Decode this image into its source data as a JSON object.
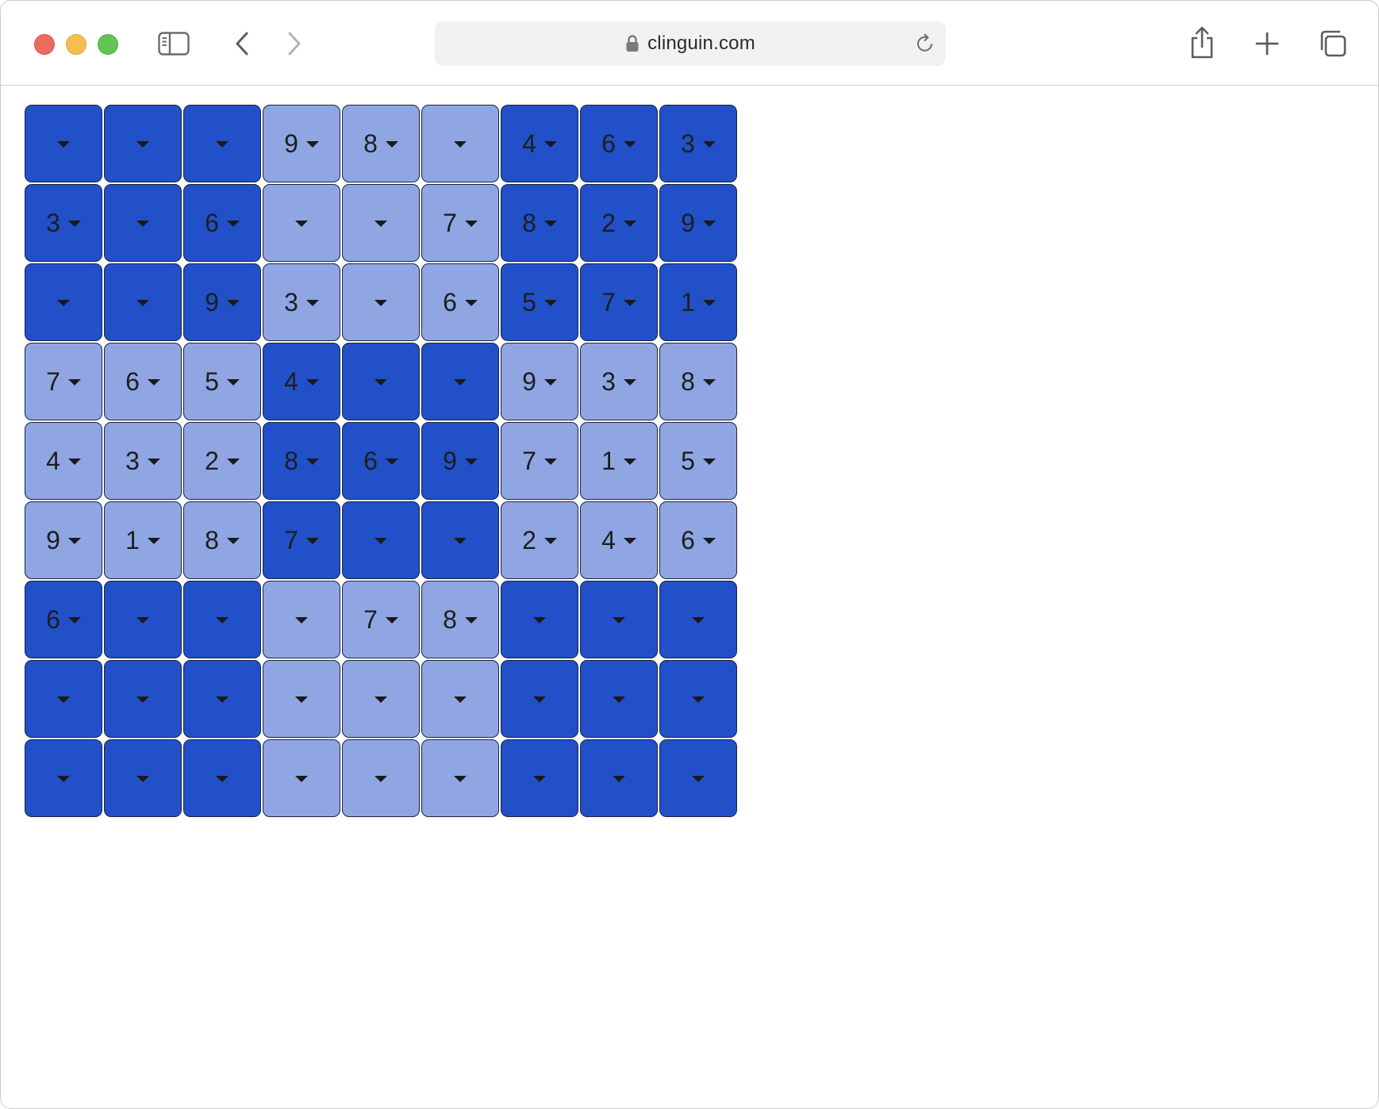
{
  "browser": {
    "url": "clinguin.com",
    "icons": {
      "sidebar": "sidebar-icon",
      "back": "chevron-left-icon",
      "forward": "chevron-right-icon",
      "lock": "lock-icon",
      "reload": "reload-icon",
      "share": "share-icon",
      "new_tab": "plus-icon",
      "tabs": "tab-overview-icon"
    }
  },
  "colors": {
    "dark_cell": "#2150c8",
    "light_cell": "#8fa6e3",
    "border": "#1b2340"
  },
  "sudoku": {
    "rows": [
      [
        "",
        "",
        "",
        "9",
        "8",
        "",
        "4",
        "6",
        "3"
      ],
      [
        "3",
        "",
        "6",
        "",
        "",
        "7",
        "8",
        "2",
        "9"
      ],
      [
        "",
        "",
        "9",
        "3",
        "",
        "6",
        "5",
        "7",
        "1"
      ],
      [
        "7",
        "6",
        "5",
        "4",
        "",
        "",
        "9",
        "3",
        "8"
      ],
      [
        "4",
        "3",
        "2",
        "8",
        "6",
        "9",
        "7",
        "1",
        "5"
      ],
      [
        "9",
        "1",
        "8",
        "7",
        "",
        "",
        "2",
        "4",
        "6"
      ],
      [
        "6",
        "",
        "",
        "",
        "7",
        "8",
        "",
        "",
        ""
      ],
      [
        "",
        "",
        "",
        "",
        "",
        "",
        "",
        "",
        ""
      ],
      [
        "",
        "",
        "",
        "",
        "",
        "",
        "",
        "",
        ""
      ]
    ]
  }
}
